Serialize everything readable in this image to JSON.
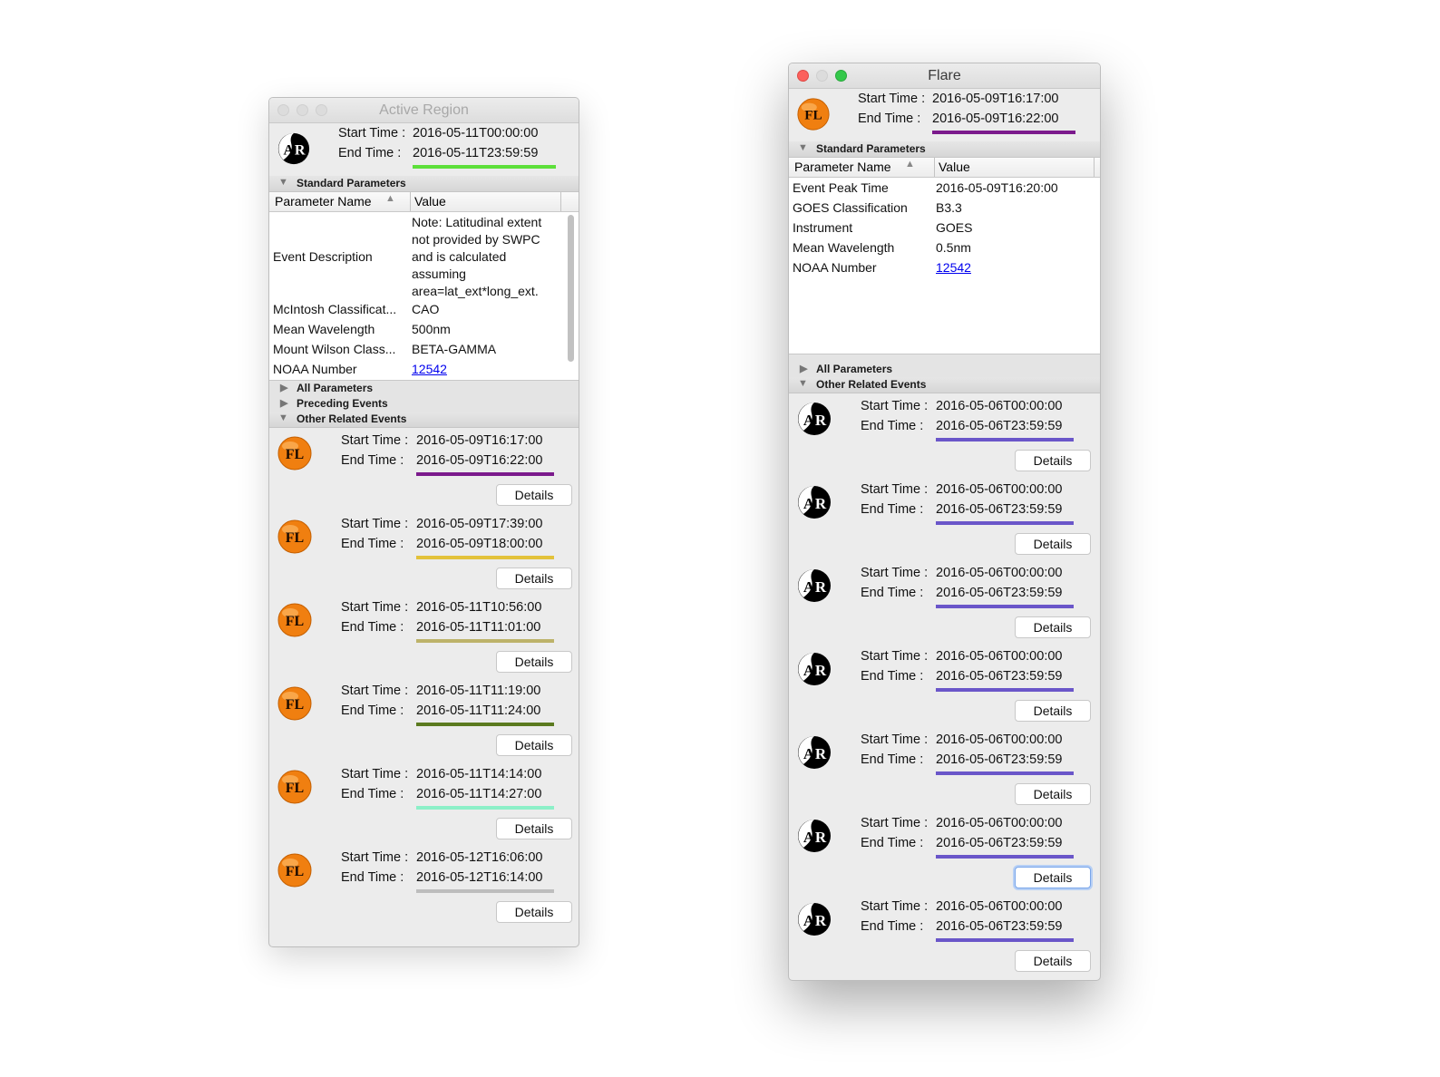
{
  "labels": {
    "start": "Start Time :",
    "end": "End Time   :",
    "details": "Details"
  },
  "colors": {
    "fl_icon": "#f07f10",
    "ar_icon": "#000000"
  },
  "icons": {
    "fl": "FL",
    "ar_a": "A",
    "ar_r": "R"
  },
  "active_region": {
    "title": "Active Region",
    "start": "2016-05-11T00:00:00",
    "end": "2016-05-11T23:59:59",
    "underline_color": "#5de03a",
    "std_params_header": "Standard Parameters",
    "col_name": "Parameter Name",
    "col_value": "Value",
    "params": [
      {
        "name": "Event Description",
        "value": "Note: Latitudinal extent\nnot provided by SWPC\nand is calculated\nassuming\narea=lat_ext*long_ext."
      },
      {
        "name": "McIntosh Classificat...",
        "value": "CAO"
      },
      {
        "name": "Mean Wavelength",
        "value": "500nm"
      },
      {
        "name": "Mount Wilson Class...",
        "value": "BETA-GAMMA"
      },
      {
        "name": "NOAA Number",
        "value": "12542"
      }
    ],
    "all_params": "All Parameters",
    "preceding": "Preceding Events",
    "other_related": "Other Related Events",
    "related": [
      {
        "type": "fl",
        "start": "2016-05-09T16:17:00",
        "end": "2016-05-09T16:22:00",
        "color": "#7b1a8c"
      },
      {
        "type": "fl",
        "start": "2016-05-09T17:39:00",
        "end": "2016-05-09T18:00:00",
        "color": "#e3c23a"
      },
      {
        "type": "fl",
        "start": "2016-05-11T10:56:00",
        "end": "2016-05-11T11:01:00",
        "color": "#bdb36a"
      },
      {
        "type": "fl",
        "start": "2016-05-11T11:19:00",
        "end": "2016-05-11T11:24:00",
        "color": "#5b7a1f"
      },
      {
        "type": "fl",
        "start": "2016-05-11T14:14:00",
        "end": "2016-05-11T14:27:00",
        "color": "#8cf0c8"
      },
      {
        "type": "fl",
        "start": "2016-05-12T16:06:00",
        "end": "2016-05-12T16:14:00",
        "color": "#bdbdbd"
      }
    ]
  },
  "flare": {
    "title": "Flare",
    "start": "2016-05-09T16:17:00",
    "end": "2016-05-09T16:22:00",
    "underline_color": "#7b1a8c",
    "std_params_header": "Standard Parameters",
    "col_name": "Parameter Name",
    "col_value": "Value",
    "params": [
      {
        "name": "Event Peak Time",
        "value": "2016-05-09T16:20:00"
      },
      {
        "name": "GOES Classification",
        "value": "B3.3"
      },
      {
        "name": "Instrument",
        "value": "GOES"
      },
      {
        "name": "Mean Wavelength",
        "value": "0.5nm"
      },
      {
        "name": "NOAA Number",
        "value": "12542"
      }
    ],
    "all_params": "All Parameters",
    "other_related": "Other Related Events",
    "related": [
      {
        "type": "ar",
        "start": "2016-05-06T00:00:00",
        "end": "2016-05-06T23:59:59",
        "color": "#6a56c9"
      },
      {
        "type": "ar",
        "start": "2016-05-06T00:00:00",
        "end": "2016-05-06T23:59:59",
        "color": "#6a56c9"
      },
      {
        "type": "ar",
        "start": "2016-05-06T00:00:00",
        "end": "2016-05-06T23:59:59",
        "color": "#6a56c9"
      },
      {
        "type": "ar",
        "start": "2016-05-06T00:00:00",
        "end": "2016-05-06T23:59:59",
        "color": "#6a56c9"
      },
      {
        "type": "ar",
        "start": "2016-05-06T00:00:00",
        "end": "2016-05-06T23:59:59",
        "color": "#6a56c9"
      },
      {
        "type": "ar",
        "start": "2016-05-06T00:00:00",
        "end": "2016-05-06T23:59:59",
        "color": "#6a56c9"
      },
      {
        "type": "ar",
        "start": "2016-05-06T00:00:00",
        "end": "2016-05-06T23:59:59",
        "color": "#6a56c9"
      }
    ],
    "focused_button_index": 5
  }
}
